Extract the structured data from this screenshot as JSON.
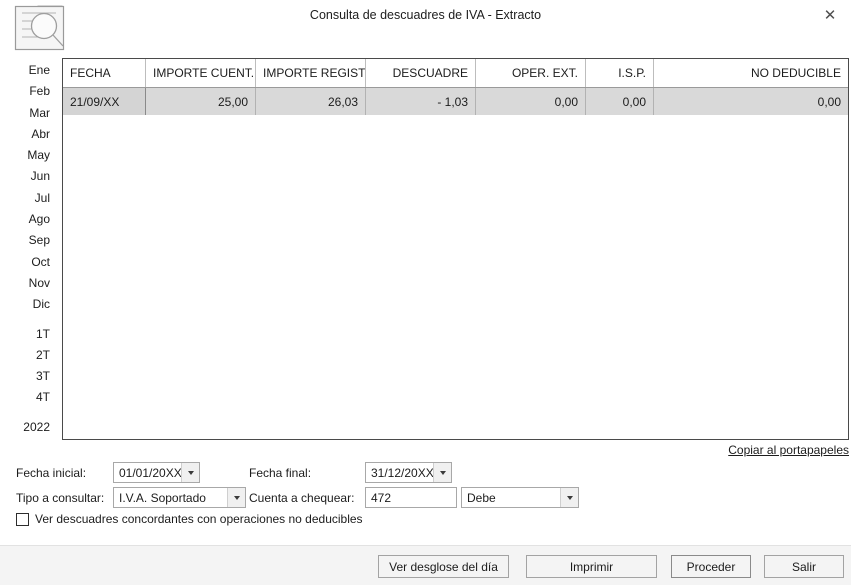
{
  "window": {
    "title": "Consulta de descuadres de IVA - Extracto",
    "close_label": "✕",
    "app_icon": "document-search-icon"
  },
  "sidebar": {
    "items": [
      {
        "label": "Ene"
      },
      {
        "label": "Feb"
      },
      {
        "label": "Mar"
      },
      {
        "label": "Abr"
      },
      {
        "label": "May"
      },
      {
        "label": "Jun"
      },
      {
        "label": "Jul"
      },
      {
        "label": "Ago"
      },
      {
        "label": "Sep"
      },
      {
        "label": "Oct"
      },
      {
        "label": "Nov"
      },
      {
        "label": "Dic"
      },
      {
        "label": "1T"
      },
      {
        "label": "2T"
      },
      {
        "label": "3T"
      },
      {
        "label": "4T"
      },
      {
        "label": "2022"
      }
    ]
  },
  "grid": {
    "columns": [
      {
        "label": "FECHA",
        "align": "left"
      },
      {
        "label": "IMPORTE CUENT...",
        "align": "left"
      },
      {
        "label": "IMPORTE REGIST...",
        "align": "left"
      },
      {
        "label": "DESCUADRE",
        "align": "right"
      },
      {
        "label": "OPER. EXT.",
        "align": "right"
      },
      {
        "label": "I.S.P.",
        "align": "right"
      },
      {
        "label": "NO DEDUCIBLE",
        "align": "right"
      }
    ],
    "rows": [
      {
        "fecha": "21/09/XX",
        "importe_cuenta": "25,00",
        "importe_registro": "26,03",
        "descuadre": "- 1,03",
        "oper_ext": "0,00",
        "isp": "0,00",
        "no_deducible": "0,00"
      }
    ],
    "copy_link": "Copiar al portapapeles"
  },
  "form": {
    "fecha_inicial_label": "Fecha inicial:",
    "fecha_inicial_value": "01/01/20XX",
    "fecha_final_label": "Fecha final:",
    "fecha_final_value": "31/12/20XX",
    "tipo_label": "Tipo a consultar:",
    "tipo_value": "I.V.A. Soportado",
    "cuenta_label": "Cuenta a chequear:",
    "cuenta_value": "472",
    "debe_value": "Debe",
    "checkbox_label": "Ver descuadres concordantes con operaciones no deducibles",
    "checkbox_checked": false
  },
  "buttons": {
    "desglose": "Ver desglose del día",
    "imprimir": "Imprimir",
    "proceder": "Proceder",
    "salir": "Salir"
  },
  "colors": {
    "row_background": "#d9d9d9",
    "bottom_bar": "#f4f4f4",
    "grid_border": "#4a4a4a"
  }
}
